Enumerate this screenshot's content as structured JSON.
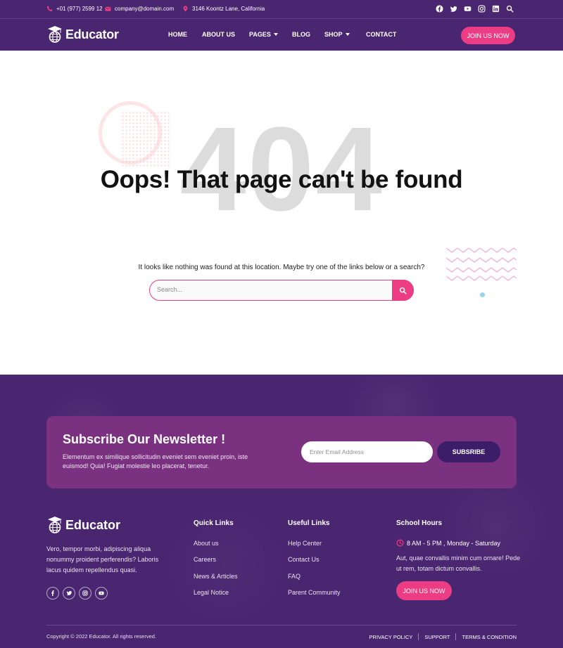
{
  "topbar": {
    "phone": "+01 (977) 2599 12",
    "email": "company@domain.com",
    "address": "3146 Koontz Lane, California",
    "social_icons": [
      "facebook-icon",
      "twitter-icon",
      "youtube-icon",
      "instagram-icon",
      "linkedin-icon",
      "search-icon"
    ]
  },
  "header": {
    "logo_text": "Educator",
    "nav": {
      "home": "HOME",
      "about": "ABOUT US",
      "pages": "PAGES",
      "blog": "BLOG",
      "shop": "SHOP",
      "contact": "CONTACT"
    },
    "join_label": "JOIN US NOW"
  },
  "error_section": {
    "big_number": "404",
    "title": "Oops! That page can't be found",
    "message": "It looks like nothing was found at this location. Maybe try one of the links below or a search?",
    "search_placeholder": "Search..."
  },
  "newsletter": {
    "title": "Subscribe Our Newsletter !",
    "description": "Elementum ex similique sollicitudin eveniet sem eveniet proin, iste euismod! Quia! Fugiat molestie leo placerat, tenetur.",
    "email_placeholder": "Enter Email Address",
    "button_label": "SUBSRIBE"
  },
  "footer": {
    "logo_text": "Educator",
    "description": "Vero, tempor morbi, adipiscing aliqua nonummy proident perferendis? Laboris lacus quidem repellendus quasi.",
    "social_icons": [
      "facebook-icon",
      "twitter-icon",
      "instagram-icon",
      "youtube-icon"
    ],
    "quick_links": {
      "heading": "Quick Links",
      "items": [
        "About us",
        "Careers",
        "News & Articles",
        "Legal Notice"
      ]
    },
    "useful_links": {
      "heading": "Useful Links",
      "items": [
        "Help Center",
        "Contact Us",
        "FAQ",
        "Parent Community"
      ]
    },
    "school_hours": {
      "heading": "School Hours",
      "hours": "8 AM - 5 PM , Monday - Saturday",
      "text": "Aut, quae convallis minim cum ornare! Pede ut rem, totam dictum convallis.",
      "join_label": "JOIN US NOW"
    },
    "copyright": "Copyright © 2022 Educator. All rights reserved.",
    "legal": [
      "PRIVACY POLICY",
      "SUPPORT",
      "TERMS & CONDITION"
    ]
  },
  "colors": {
    "header_bg": "#4a2570",
    "accent": "#ec3d84",
    "newsletter_bg": "#7a3280",
    "big_404": "#dcdcdc"
  }
}
